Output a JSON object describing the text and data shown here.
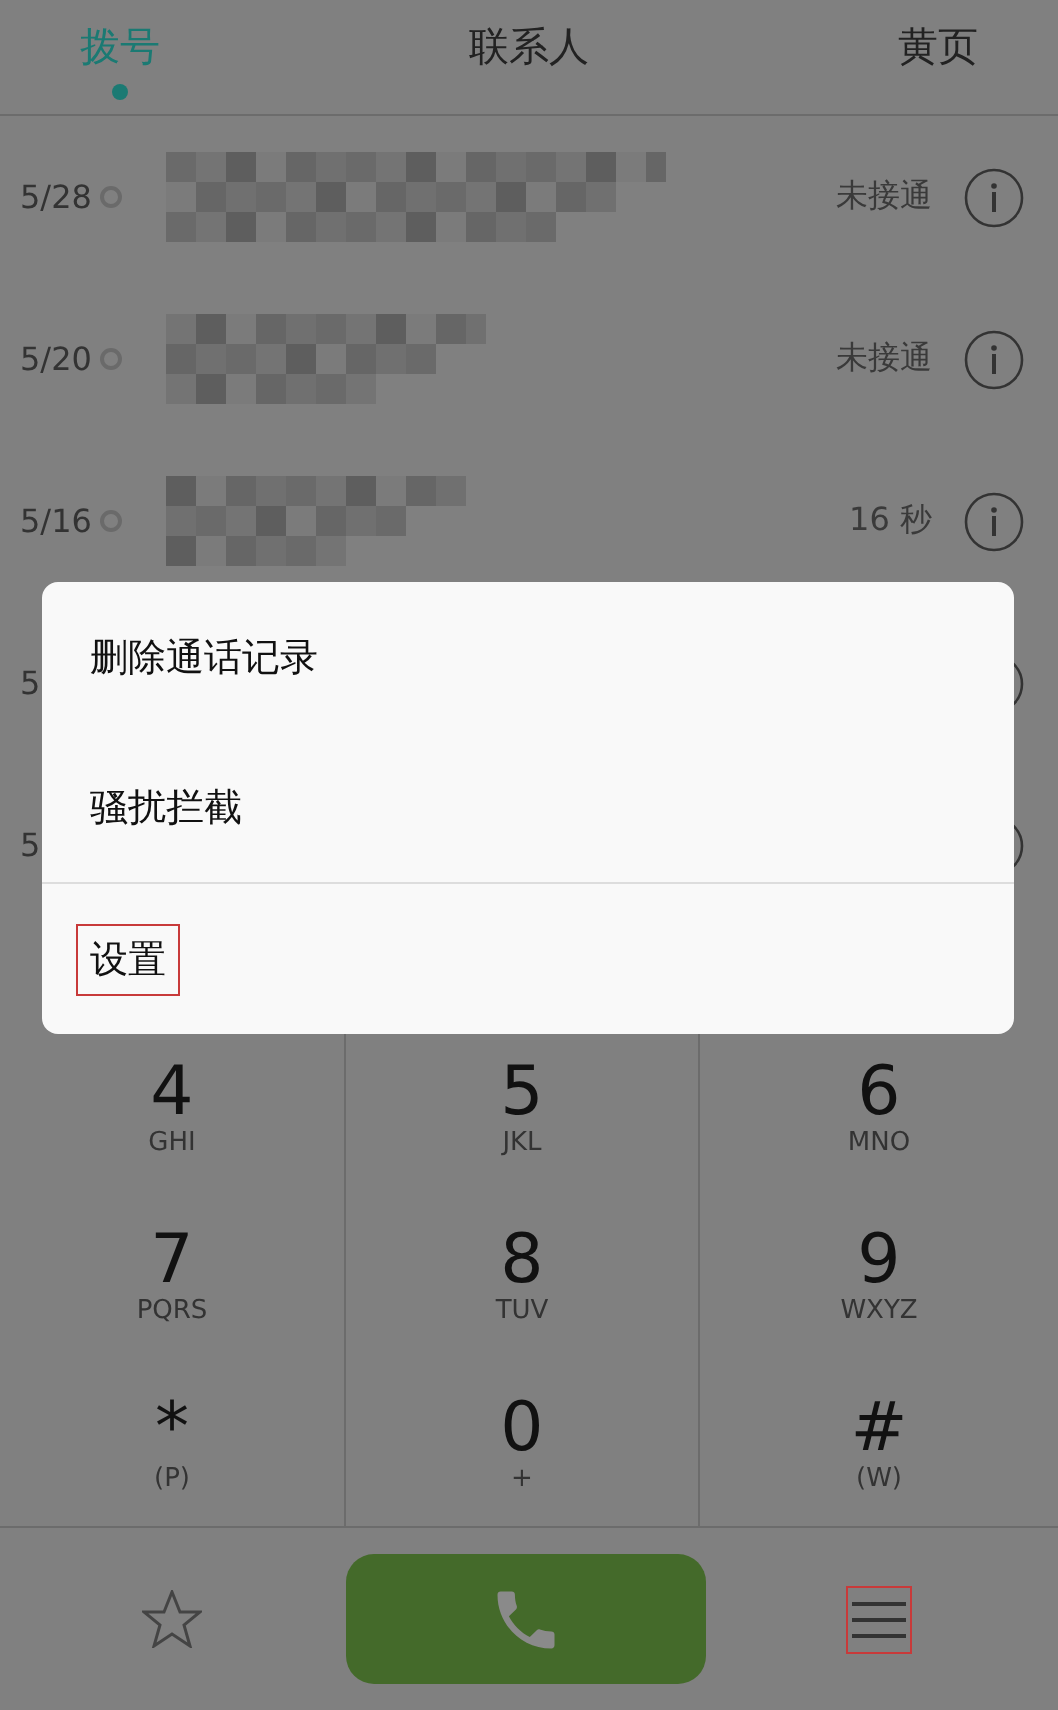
{
  "tabs": [
    {
      "label": "拨号",
      "selected": true
    },
    {
      "label": "联系人",
      "selected": false
    },
    {
      "label": "黄页",
      "selected": false
    }
  ],
  "calls": [
    {
      "date": "5/28",
      "status": "未接通"
    },
    {
      "date": "5/20",
      "status": "未接通"
    },
    {
      "date": "5/16",
      "status": "16 秒"
    },
    {
      "date": "5"
    },
    {
      "date": "5"
    }
  ],
  "keys": [
    {
      "digit": "4",
      "letters": "GHI"
    },
    {
      "digit": "5",
      "letters": "JKL"
    },
    {
      "digit": "6",
      "letters": "MNO"
    },
    {
      "digit": "7",
      "letters": "PQRS"
    },
    {
      "digit": "8",
      "letters": "TUV"
    },
    {
      "digit": "9",
      "letters": "WXYZ"
    },
    {
      "digit": "*",
      "letters": "(P)"
    },
    {
      "digit": "0",
      "letters": "+"
    },
    {
      "digit": "#",
      "letters": "(W)"
    }
  ],
  "menu": [
    {
      "label": "删除通话记录",
      "highlighted": false
    },
    {
      "label": "骚扰拦截",
      "highlighted": false
    },
    {
      "label": "设置",
      "highlighted": true
    }
  ],
  "menu_button": {
    "highlighted": true
  }
}
